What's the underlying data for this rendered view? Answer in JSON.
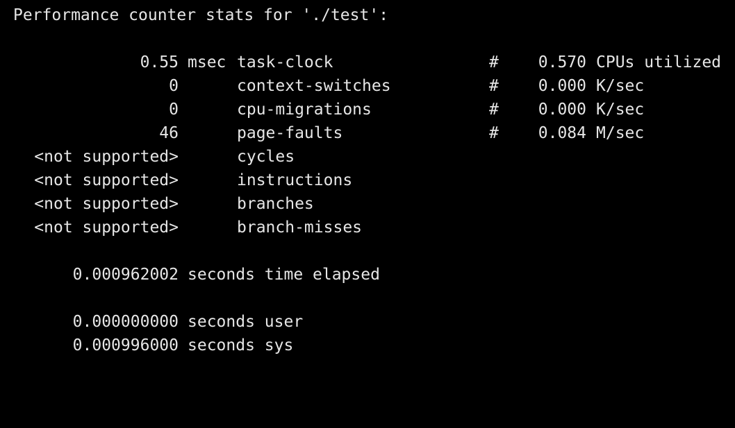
{
  "header": "Performance counter stats for './test':",
  "counters": [
    {
      "value": "0.55",
      "unit": "msec",
      "event": "task-clock",
      "hash": "#",
      "metric": "0.570",
      "metric_desc": "CPUs utilized"
    },
    {
      "value": "0",
      "unit": "",
      "event": "context-switches",
      "hash": "#",
      "metric": "0.000",
      "metric_desc": "K/sec"
    },
    {
      "value": "0",
      "unit": "",
      "event": "cpu-migrations",
      "hash": "#",
      "metric": "0.000",
      "metric_desc": "K/sec"
    },
    {
      "value": "46",
      "unit": "",
      "event": "page-faults",
      "hash": "#",
      "metric": "0.084",
      "metric_desc": "M/sec"
    },
    {
      "value": "<not supported>",
      "unit": "",
      "event": "cycles",
      "hash": "",
      "metric": "",
      "metric_desc": ""
    },
    {
      "value": "<not supported>",
      "unit": "",
      "event": "instructions",
      "hash": "",
      "metric": "",
      "metric_desc": ""
    },
    {
      "value": "<not supported>",
      "unit": "",
      "event": "branches",
      "hash": "",
      "metric": "",
      "metric_desc": ""
    },
    {
      "value": "<not supported>",
      "unit": "",
      "event": "branch-misses",
      "hash": "",
      "metric": "",
      "metric_desc": ""
    }
  ],
  "timing": {
    "elapsed": {
      "value": "0.000962002",
      "label": "seconds time elapsed"
    },
    "user": {
      "value": "0.000000000",
      "label": "seconds user"
    },
    "sys": {
      "value": "0.000996000",
      "label": "seconds sys"
    }
  },
  "colors": {
    "background": "#000000",
    "text": "#e6e6e6"
  }
}
